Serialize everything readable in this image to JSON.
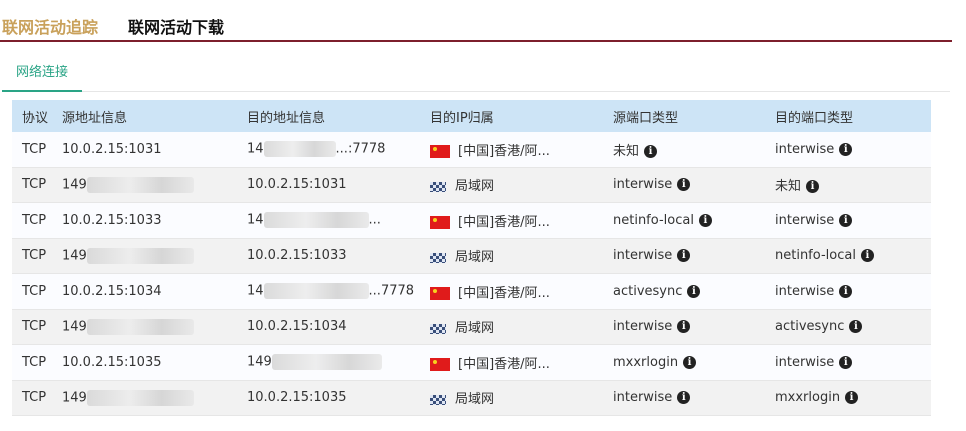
{
  "tabs": {
    "tracking": "联网活动追踪",
    "download": "联网活动下载"
  },
  "subtab": "网络连接",
  "columns": [
    "协议",
    "源地址信息",
    "目的地址信息",
    "目的IP归属",
    "源端口类型",
    "目的端口类型"
  ],
  "rows": [
    {
      "proto": "TCP",
      "src_text": "10.0.2.15:1031",
      "dst_prefix": "14",
      "dst_suffix": "...:7778",
      "dst_text": "",
      "geo_icon": "china-flag-icon",
      "geo": "[中国]香港/阿...",
      "src_port": "未知",
      "dst_port": "interwise"
    },
    {
      "proto": "TCP",
      "src_prefix": "149",
      "src_text": "",
      "dst_text": "10.0.2.15:1031",
      "geo_icon": "lan-icon",
      "geo": "局域网",
      "src_port": "interwise",
      "dst_port": "未知"
    },
    {
      "proto": "TCP",
      "src_text": "10.0.2.15:1033",
      "dst_prefix": "14",
      "dst_suffix": "...",
      "dst_text": "",
      "geo_icon": "china-flag-icon",
      "geo": "[中国]香港/阿...",
      "src_port": "netinfo-local",
      "dst_port": "interwise"
    },
    {
      "proto": "TCP",
      "src_prefix": "149",
      "src_text": "",
      "dst_text": "10.0.2.15:1033",
      "geo_icon": "lan-icon",
      "geo": "局域网",
      "src_port": "interwise",
      "dst_port": "netinfo-local"
    },
    {
      "proto": "TCP",
      "src_text": "10.0.2.15:1034",
      "dst_prefix": "14",
      "dst_suffix": "...7778",
      "dst_text": "",
      "geo_icon": "china-flag-icon",
      "geo": "[中国]香港/阿...",
      "src_port": "activesync",
      "dst_port": "interwise"
    },
    {
      "proto": "TCP",
      "src_prefix": "149",
      "src_text": "",
      "dst_text": "10.0.2.15:1034",
      "geo_icon": "lan-icon",
      "geo": "局域网",
      "src_port": "interwise",
      "dst_port": "activesync"
    },
    {
      "proto": "TCP",
      "src_text": "10.0.2.15:1035",
      "dst_prefix": "149",
      "dst_suffix": "",
      "dst_text": "",
      "geo_icon": "china-flag-icon",
      "geo": "[中国]香港/阿...",
      "src_port": "mxxrlogin",
      "dst_port": "interwise"
    },
    {
      "proto": "TCP",
      "src_prefix": "149",
      "src_text": "",
      "dst_text": "10.0.2.15:1035",
      "geo_icon": "lan-icon",
      "geo": "局域网",
      "src_port": "interwise",
      "dst_port": "mxxrlogin"
    }
  ],
  "info_glyph": "i",
  "colors": {
    "accent_tab": "#c9a15b",
    "underline": "#7d1f2c",
    "subtab": "#2aa486",
    "header_bg": "#cde4f6"
  }
}
